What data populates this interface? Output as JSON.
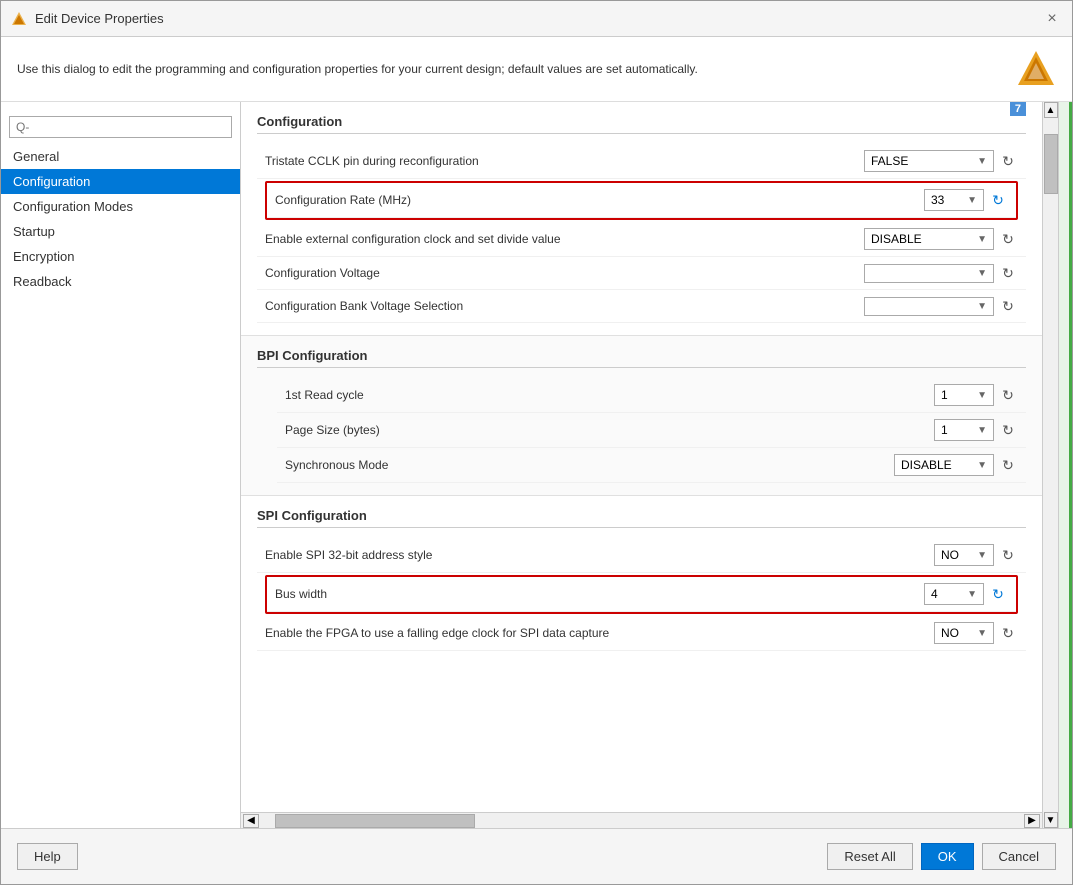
{
  "window": {
    "title": "Edit Device Properties",
    "close_label": "×"
  },
  "info": {
    "text": "Use this dialog to edit the programming and configuration properties for your current design; default values are set automatically."
  },
  "sidebar": {
    "search_placeholder": "Q-",
    "items": [
      {
        "label": "General",
        "active": false
      },
      {
        "label": "Configuration",
        "active": true
      },
      {
        "label": "Configuration Modes",
        "active": false
      },
      {
        "label": "Startup",
        "active": false
      },
      {
        "label": "Encryption",
        "active": false
      },
      {
        "label": "Readback",
        "active": false
      }
    ]
  },
  "configuration": {
    "section_title": "Configuration",
    "properties": [
      {
        "label": "Tristate CCLK pin during reconfiguration",
        "value": "FALSE",
        "highlighted": false
      },
      {
        "label": "Configuration Rate (MHz)",
        "value": "33",
        "highlighted": true
      },
      {
        "label": "Enable external configuration clock and set divide value",
        "value": "DISABLE",
        "highlighted": false
      },
      {
        "label": "Configuration Voltage",
        "value": "",
        "highlighted": false
      },
      {
        "label": "Configuration Bank Voltage Selection",
        "value": "",
        "highlighted": false
      }
    ]
  },
  "bpi": {
    "section_title": "BPI Configuration",
    "properties": [
      {
        "label": "1st Read cycle",
        "value": "1"
      },
      {
        "label": "Page Size (bytes)",
        "value": "1"
      },
      {
        "label": "Synchronous Mode",
        "value": "DISABLE"
      }
    ]
  },
  "spi": {
    "section_title": "SPI Configuration",
    "properties": [
      {
        "label": "Enable SPI 32-bit address style",
        "value": "NO",
        "highlighted": false
      },
      {
        "label": "Bus width",
        "value": "4",
        "highlighted": true
      },
      {
        "label": "Enable the FPGA to use a falling edge clock for SPI data capture",
        "value": "NO",
        "highlighted": false
      }
    ]
  },
  "footer": {
    "help_label": "Help",
    "reset_label": "Reset All",
    "ok_label": "OK",
    "cancel_label": "Cancel"
  },
  "number_badge": "7"
}
